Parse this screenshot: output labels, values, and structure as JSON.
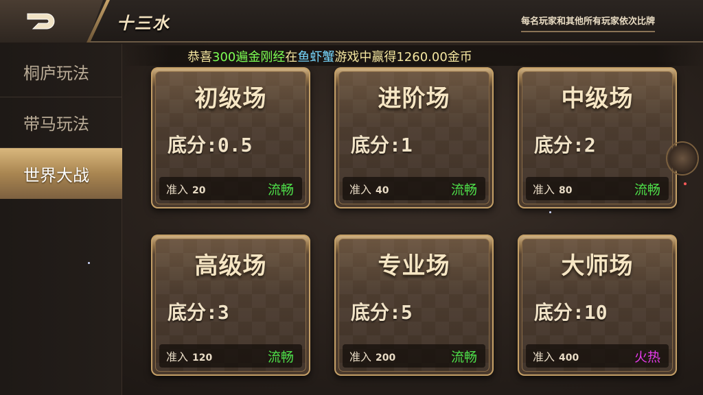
{
  "header": {
    "title": "十三水",
    "rule_text": "每名玩家和其他所有玩家依次比牌"
  },
  "marquee": {
    "prefix": "恭喜",
    "player": "300遍金刚经",
    "mid": "在",
    "game": "鱼虾蟹",
    "suffix": "游戏中赢得1260.00金币"
  },
  "sidebar": {
    "items": [
      {
        "label": "桐庐玩法",
        "active": false
      },
      {
        "label": "带马玩法",
        "active": false
      },
      {
        "label": "世界大战",
        "active": true
      }
    ]
  },
  "rooms": [
    {
      "name": "初级场",
      "base_label": "底分:",
      "base_value": "0.5",
      "enter_label": "准入",
      "enter_value": "20",
      "status": "流畅"
    },
    {
      "name": "进阶场",
      "base_label": "底分:",
      "base_value": "1",
      "enter_label": "准入",
      "enter_value": "40",
      "status": "流畅"
    },
    {
      "name": "中级场",
      "base_label": "底分:",
      "base_value": "2",
      "enter_label": "准入",
      "enter_value": "80",
      "status": "流畅"
    },
    {
      "name": "高级场",
      "base_label": "底分:",
      "base_value": "3",
      "enter_label": "准入",
      "enter_value": "120",
      "status": "流畅"
    },
    {
      "name": "专业场",
      "base_label": "底分:",
      "base_value": "5",
      "enter_label": "准入",
      "enter_value": "200",
      "status": "流畅"
    },
    {
      "name": "大师场",
      "base_label": "底分:",
      "base_value": "10",
      "enter_label": "准入",
      "enter_value": "400",
      "status": "火热"
    }
  ],
  "colors": {
    "accent_gold": "#c5a067",
    "status_smooth": "#4ee04a",
    "status_hot": "#e23be8",
    "marquee_player": "#7dff54",
    "marquee_game": "#78d8ff"
  }
}
